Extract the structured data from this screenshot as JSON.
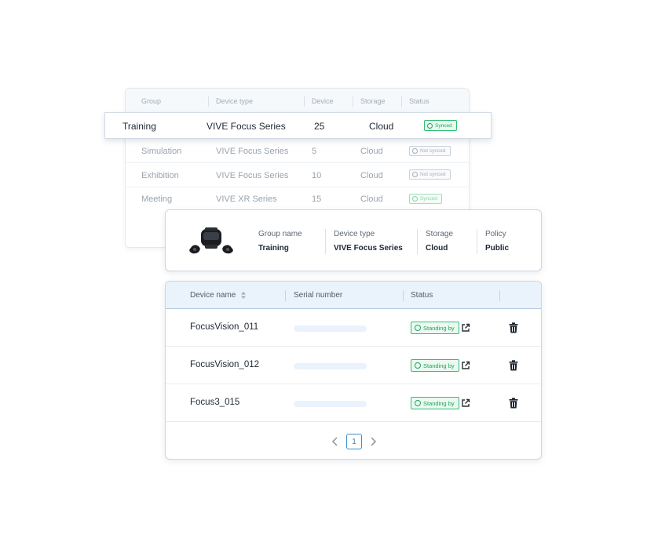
{
  "groups_table": {
    "headers": [
      "Group",
      "Device type",
      "Device",
      "Storage",
      "Status"
    ],
    "rows": [
      {
        "group": "Training",
        "device_type": "VIVE Focus Series",
        "device": "25",
        "storage": "Cloud",
        "status": "Synced"
      },
      {
        "group": "Simulation",
        "device_type": "VIVE Focus Series",
        "device": "5",
        "storage": "Cloud",
        "status": "Not synced"
      },
      {
        "group": "Exhibition",
        "device_type": "VIVE Focus Series",
        "device": "10",
        "storage": "Cloud",
        "status": "Not synced"
      },
      {
        "group": "Meeting",
        "device_type": "VIVE XR Series",
        "device": "15",
        "storage": "Cloud",
        "status": "Synced"
      }
    ]
  },
  "group_detail": {
    "image_icon": "vr-headset-with-controllers",
    "group_name_label": "Group name",
    "group_name": "Training",
    "device_type_label": "Device type",
    "device_type": "VIVE Focus Series",
    "storage_label": "Storage",
    "storage": "Cloud",
    "policy_label": "Policy",
    "policy": "Public"
  },
  "devices_table": {
    "headers": {
      "device_name": "Device name",
      "serial_number": "Serial number",
      "status": "Status"
    },
    "rows": [
      {
        "name": "FocusVision_011",
        "status": "Standing by"
      },
      {
        "name": "FocusVision_012",
        "status": "Standing by"
      },
      {
        "name": "Focus3_015",
        "status": "Standing by"
      }
    ],
    "pagination": {
      "current_page": "1"
    }
  },
  "colors": {
    "accent": "#3d8fc9",
    "synced_green": "#21a35c",
    "not_synced_gray": "#a7b0ba",
    "header_blue": "#eaf3fb"
  }
}
